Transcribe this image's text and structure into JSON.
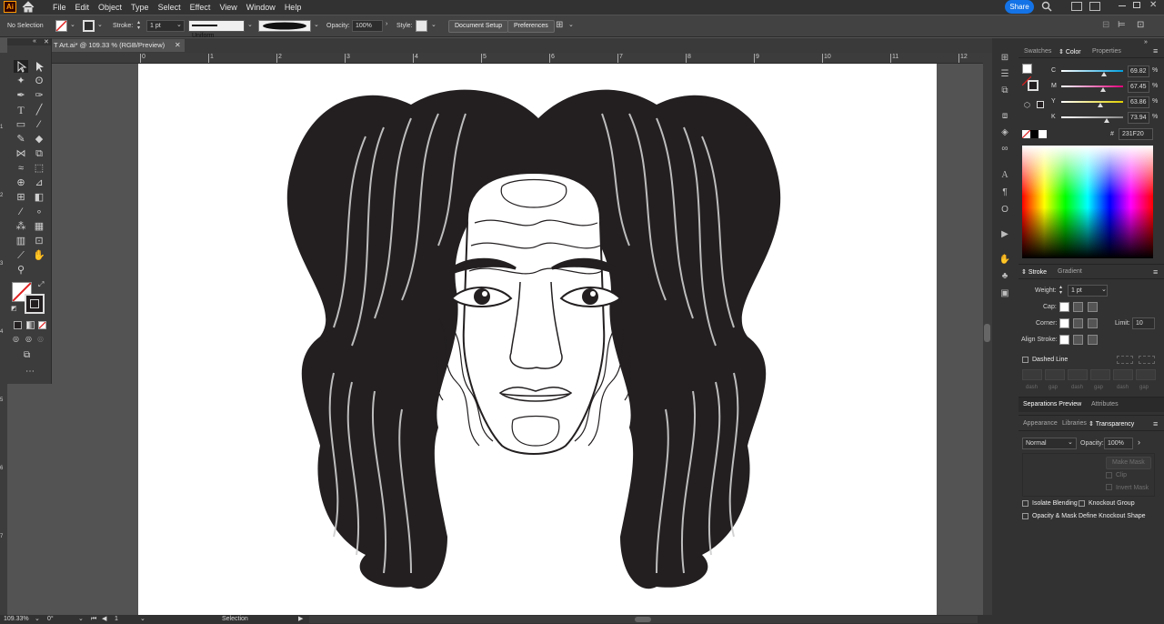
{
  "menu": {
    "logo": "Ai",
    "items": [
      "File",
      "Edit",
      "Object",
      "Type",
      "Select",
      "Effect",
      "View",
      "Window",
      "Help"
    ],
    "share_label": "Share"
  },
  "control": {
    "selection": "No Selection",
    "stroke_label": "Stroke:",
    "stroke_weight": "1 pt",
    "profile": "Uniform",
    "opacity_label": "Opacity:",
    "opacity": "100%",
    "style_label": "Style:",
    "doc_setup": "Document Setup",
    "preferences": "Preferences"
  },
  "document": {
    "tab_title": "T Art.ai* @ 109.33 % (RGB/Preview)",
    "ruler_ticks": [
      "0",
      "1",
      "2",
      "3",
      "4",
      "5",
      "6",
      "7",
      "8",
      "9",
      "10",
      "11",
      "12"
    ],
    "left_ticks": [
      "1",
      "2",
      "3",
      "4",
      "5",
      "6",
      "7"
    ]
  },
  "status": {
    "zoom": "109.33%",
    "rotation": "0°",
    "artboard": "1",
    "tool": "Selection"
  },
  "color_panel": {
    "tabs": [
      "Swatches",
      "Color",
      "Properties"
    ],
    "active_tab": "Color",
    "channels": [
      {
        "label": "C",
        "value": "69.82",
        "level": 0.6982
      },
      {
        "label": "M",
        "value": "67.45",
        "level": 0.6745
      },
      {
        "label": "Y",
        "value": "63.86",
        "level": 0.6386
      },
      {
        "label": "K",
        "value": "73.94",
        "level": 0.7394
      }
    ],
    "percent": "%",
    "hex_prefix": "#",
    "hex": "231F20"
  },
  "stroke_panel": {
    "tabs": [
      "Stroke",
      "Gradient"
    ],
    "weight_label": "Weight:",
    "weight": "1 pt",
    "cap_label": "Cap:",
    "corner_label": "Corner:",
    "limit_label": "Limit:",
    "limit": "10",
    "align_label": "Align Stroke:",
    "dashed_label": "Dashed Line",
    "dash_labels": [
      "dash",
      "gap",
      "dash",
      "gap",
      "dash",
      "gap"
    ]
  },
  "sep_panel": {
    "tabs": [
      "Separations Preview",
      "Attributes"
    ]
  },
  "transparency_panel": {
    "tabs": [
      "Appearance",
      "Libraries",
      "Transparency"
    ],
    "blend_mode": "Normal",
    "opacity_label": "Opacity:",
    "opacity": "100%",
    "make_mask": "Make Mask",
    "clip": "Clip",
    "invert_mask": "Invert Mask",
    "isolate": "Isolate Blending",
    "knockout": "Knockout Group",
    "opacity_mask": "Opacity & Mask Define Knockout Shape"
  }
}
